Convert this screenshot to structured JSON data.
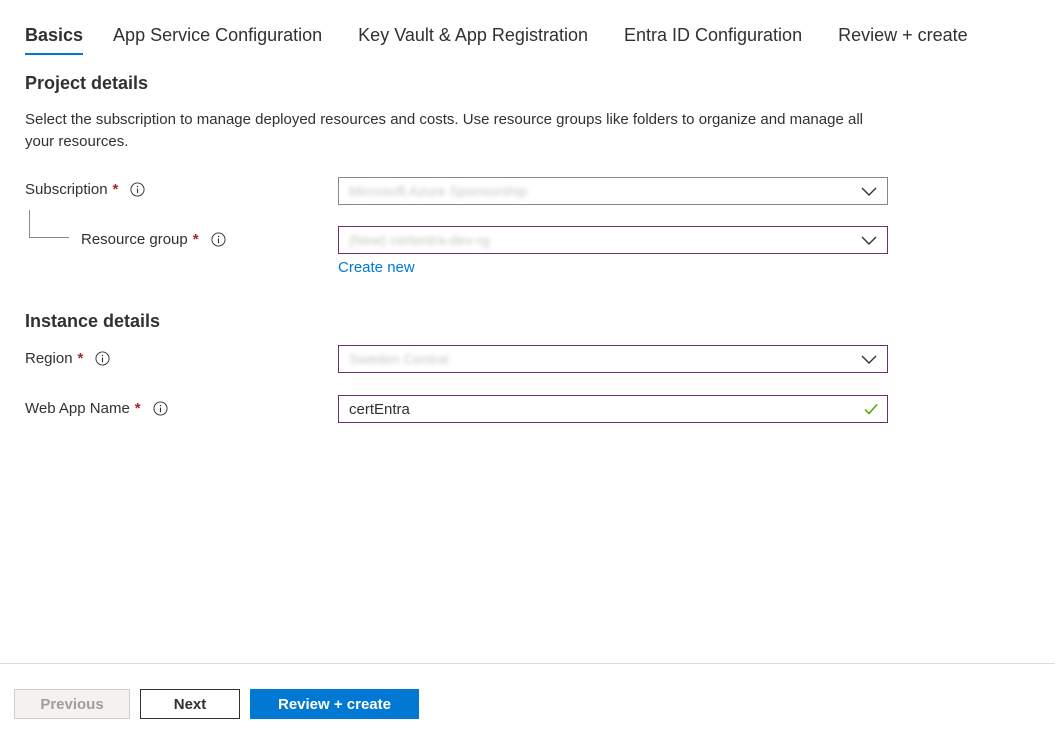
{
  "tabs": [
    {
      "label": "Basics",
      "active": true
    },
    {
      "label": "App Service Configuration",
      "active": false
    },
    {
      "label": "Key Vault & App Registration",
      "active": false
    },
    {
      "label": "Entra ID Configuration",
      "active": false
    },
    {
      "label": "Review + create",
      "active": false
    }
  ],
  "project": {
    "title": "Project details",
    "description": "Select the subscription to manage deployed resources and costs. Use resource groups like folders to organize and manage all your resources."
  },
  "subscription": {
    "label": "Subscription",
    "required_mark": "*",
    "value": "Microsoft Azure Sponsorship",
    "icon": "info-icon"
  },
  "resource_group": {
    "label": "Resource group",
    "required_mark": "*",
    "value": "(New) certentra-dev-rg",
    "icon": "info-icon",
    "create_new_label": "Create new"
  },
  "instance": {
    "title": "Instance details"
  },
  "region": {
    "label": "Region",
    "required_mark": "*",
    "value": "Sweden Central",
    "icon": "info-icon"
  },
  "web_app_name": {
    "label": "Web App Name",
    "required_mark": "*",
    "value": "certEntra",
    "valid": true,
    "icon": "info-icon"
  },
  "footer": {
    "previous_label": "Previous",
    "next_label": "Next",
    "review_label": "Review + create"
  },
  "colors": {
    "accent": "#0078d4",
    "focus_border": "#6b2c7a",
    "required": "#a4262c",
    "valid": "#57a300"
  }
}
